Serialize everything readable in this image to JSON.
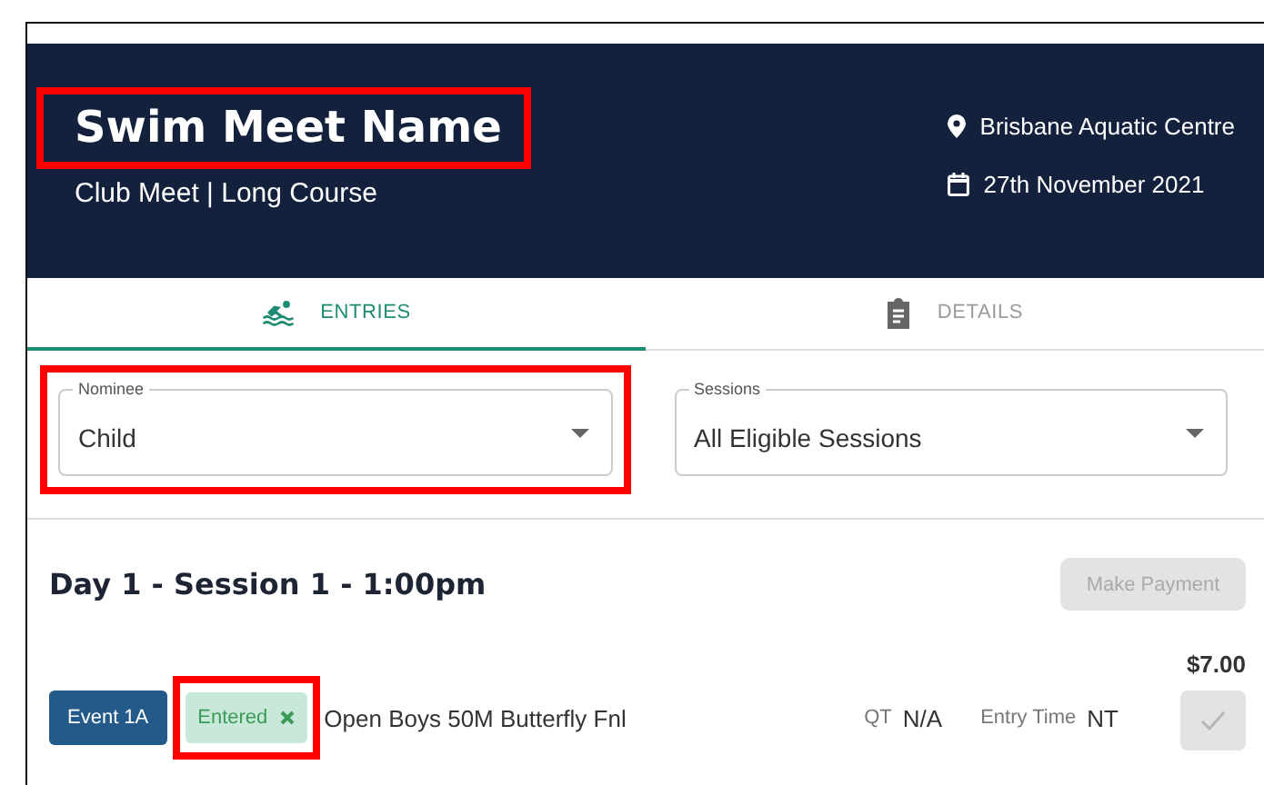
{
  "meet": {
    "title": "Swim Meet Name",
    "title_highlighted": true,
    "subtitle": "Club Meet | Long Course",
    "location": "Brisbane Aquatic Centre",
    "date": "27th November 2021"
  },
  "tabs": [
    {
      "label": "ENTRIES",
      "kind": "swimmer",
      "selected": true
    },
    {
      "label": "DETAILS",
      "kind": "clipboard",
      "selected": false
    }
  ],
  "filters": [
    {
      "label": "Nominee",
      "value": "Child",
      "highlighted": true
    },
    {
      "label": "Sessions",
      "value": "All Eligible Sessions",
      "highlighted": false
    }
  ],
  "session": {
    "heading": "Day 1 - Session 1 - 1:00pm",
    "payment_button": {
      "label": "Make Payment",
      "disabled": true
    },
    "events": [
      {
        "event": "Event 1A",
        "status": "Entered",
        "status_highlighted": true,
        "name": "Open Boys 50M Butterfly Fnl",
        "qt_label": "QT",
        "qt": "N/A",
        "entry_time_label": "Entry Time",
        "entry_time": "NT",
        "price": "$7.00",
        "select_disabled": true
      }
    ]
  }
}
